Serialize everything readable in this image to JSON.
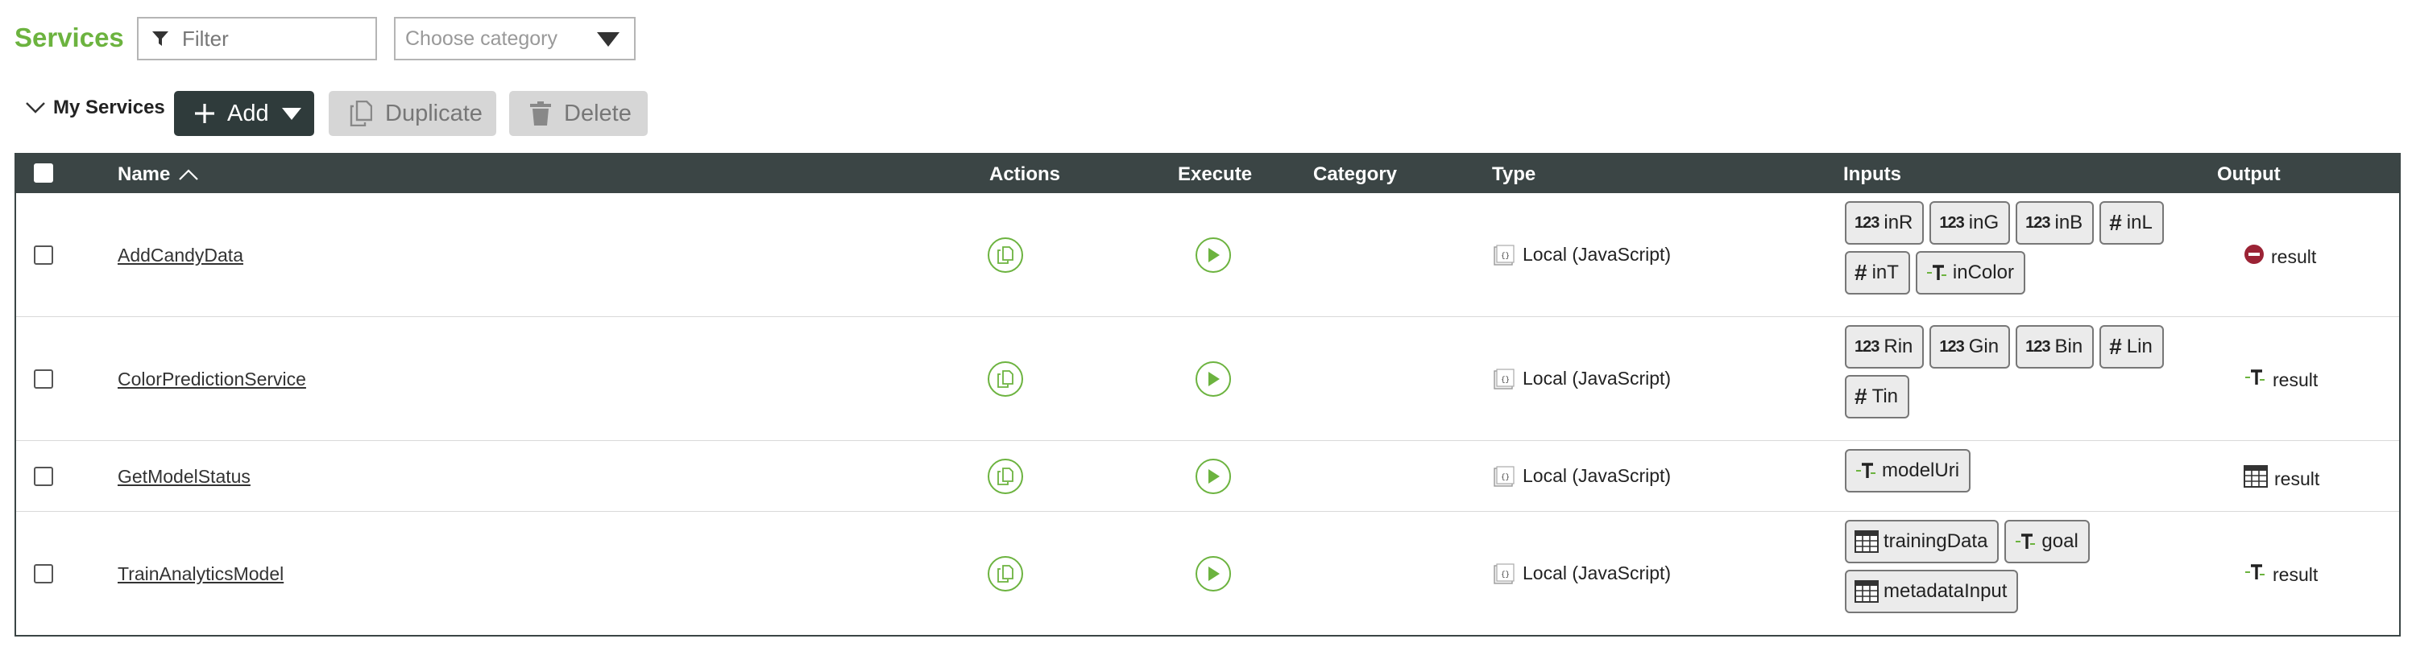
{
  "header": {
    "title": "Services",
    "filter_placeholder": "Filter",
    "category_placeholder": "Choose category"
  },
  "toolbar": {
    "section_label": "My Services",
    "add_label": "Add",
    "duplicate_label": "Duplicate",
    "delete_label": "Delete"
  },
  "table": {
    "columns": {
      "name": "Name",
      "actions": "Actions",
      "execute": "Execute",
      "category": "Category",
      "type": "Type",
      "inputs": "Inputs",
      "output": "Output"
    },
    "rows": [
      {
        "name": "AddCandyData",
        "category": "",
        "type": "Local (JavaScript)",
        "inputs": [
          {
            "icon": "number-123-icon",
            "label": "inR"
          },
          {
            "icon": "number-123-icon",
            "label": "inG"
          },
          {
            "icon": "number-123-icon",
            "label": "inB"
          },
          {
            "icon": "hash-icon",
            "label": "inL"
          },
          {
            "icon": "hash-icon",
            "label": "inT"
          },
          {
            "icon": "text-type-icon",
            "label": "inColor"
          }
        ],
        "output": {
          "icon": "no-entry-icon",
          "label": "result"
        }
      },
      {
        "name": "ColorPredictionService",
        "category": "",
        "type": "Local (JavaScript)",
        "inputs": [
          {
            "icon": "number-123-icon",
            "label": "Rin"
          },
          {
            "icon": "number-123-icon",
            "label": "Gin"
          },
          {
            "icon": "number-123-icon",
            "label": "Bin"
          },
          {
            "icon": "hash-icon",
            "label": "Lin"
          },
          {
            "icon": "hash-icon",
            "label": "Tin"
          }
        ],
        "output": {
          "icon": "text-type-icon",
          "label": "result"
        }
      },
      {
        "name": "GetModelStatus",
        "category": "",
        "type": "Local (JavaScript)",
        "inputs": [
          {
            "icon": "text-type-icon",
            "label": "modelUri"
          }
        ],
        "output": {
          "icon": "table-icon",
          "label": "result"
        }
      },
      {
        "name": "TrainAnalyticsModel",
        "category": "",
        "type": "Local (JavaScript)",
        "inputs": [
          {
            "icon": "table-icon",
            "label": "trainingData"
          },
          {
            "icon": "text-type-icon",
            "label": "goal"
          },
          {
            "icon": "table-icon",
            "label": "metadataInput"
          }
        ],
        "output": {
          "icon": "text-type-icon",
          "label": "result"
        }
      }
    ]
  },
  "colors": {
    "accent": "#6cb33f",
    "header_bg": "#3b4545",
    "chip_bg": "#ebebeb",
    "error": "#9b2335"
  }
}
